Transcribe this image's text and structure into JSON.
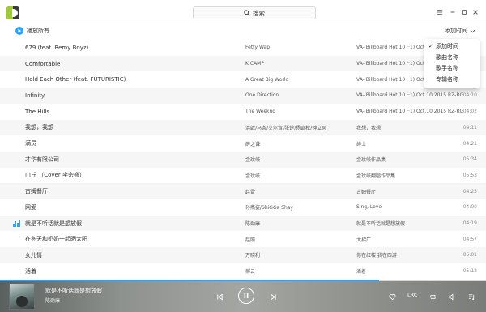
{
  "search": {
    "label": "搜索"
  },
  "toolbar": {
    "play_all": "播放所有",
    "sort_label": "添加时间"
  },
  "sort_menu": {
    "options": [
      "添加时间",
      "歌曲名称",
      "歌手名称",
      "专辑名称"
    ],
    "selected": "添加时间"
  },
  "songs": [
    {
      "title": "679 (feat. Remy Boyz)",
      "artist": "Fetty Wap",
      "album": "VA- Billboard Hot 10 ··1) Oct.10 2015 RZ-RG",
      "duration": ""
    },
    {
      "title": "Comfortable",
      "artist": "K CAMP",
      "album": "VA- Billboard Hot 10 ··1) Oct.1",
      "duration": ""
    },
    {
      "title": "Hold Each Other (feat. FUTURISTIC)",
      "artist": "A Great Big World",
      "album": "VA- Billboard Hot 10 ··1) Oct.1",
      "duration": ""
    },
    {
      "title": "Infinity",
      "artist": "One Direction",
      "album": "VA- Billboard Hot 10 ··1) Oct.10 2015 RZ-RG",
      "duration": "04:10"
    },
    {
      "title": "The Hills",
      "artist": "The Weeknd",
      "album": "VA- Billboard Hot 10 ··1) Oct.10 2015 RZ-RG",
      "duration": "04:02"
    },
    {
      "title": "我想，我想",
      "artist": "洪啟/马条/艾尔肯/张楚/杨嘉松/钟立风",
      "album": "我想，我想",
      "duration": "04:11"
    },
    {
      "title": "满员",
      "artist": "薛之谦",
      "album": "绅士",
      "duration": "04:21"
    },
    {
      "title": "才华有限公司",
      "artist": "金玟岐",
      "album": "金玟岐作品集",
      "duration": "05:34"
    },
    {
      "title": "山丘 （Cover 李宗盛）",
      "artist": "金玟岐",
      "album": "金玟岐翻唱作品集",
      "duration": "05:53"
    },
    {
      "title": "古姆餐厅",
      "artist": "赵雷",
      "album": "古姆餐厅",
      "duration": "04:25"
    },
    {
      "title": "网爱",
      "artist": "孙燕姿/ShiGGa Shay",
      "album": "Sing, Love",
      "duration": "04:00"
    },
    {
      "title": "就是不听话就是想放假",
      "artist": "陈劲康",
      "album": "就是不听话就是想放假",
      "duration": "04:19"
    },
    {
      "title": "在冬天和奶奶一起晒太阳",
      "artist": "赵照",
      "album": "大招厂",
      "duration": "04:57"
    },
    {
      "title": "女儿情",
      "artist": "万晓利",
      "album": "你在红楼 我在西游",
      "duration": "05:01"
    },
    {
      "title": "活着",
      "artist": "郝云",
      "album": "活着",
      "duration": "05:12"
    }
  ],
  "playing_index": 11,
  "player": {
    "title": "就是不听话就是想放假",
    "artist": "陈劲康",
    "lrc_label": "LRC",
    "progress": 0.78
  },
  "colors": {
    "accent": "#2ca2f8",
    "row_alt": "#f6f6f6"
  }
}
